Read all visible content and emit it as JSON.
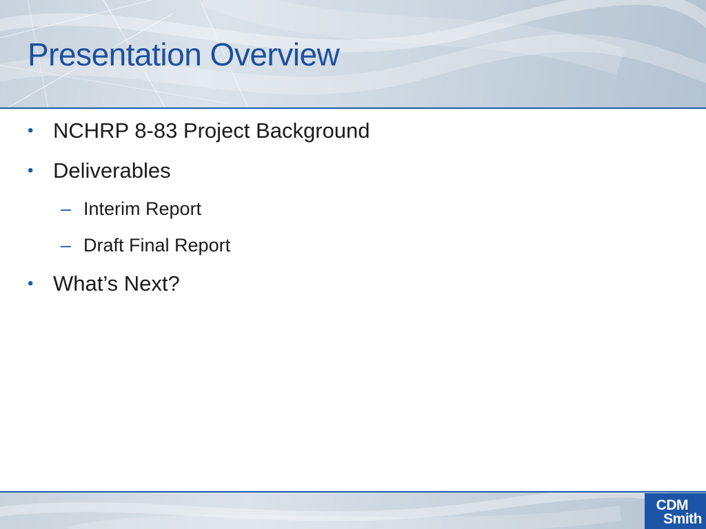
{
  "slide": {
    "title": "Presentation Overview",
    "bullets": [
      {
        "level": 1,
        "text": "NCHRP 8-83 Project Background"
      },
      {
        "level": 1,
        "text": "Deliverables"
      },
      {
        "level": 2,
        "text": "Interim Report"
      },
      {
        "level": 2,
        "text": "Draft Final Report"
      },
      {
        "level": 1,
        "text": "What’s Next?"
      }
    ],
    "markers": {
      "level1": "•",
      "level2": "–"
    }
  },
  "logo": {
    "line1": "CDM",
    "line2": "Smith"
  },
  "colors": {
    "title": "#1d4f9e",
    "accent": "#1f5aa8",
    "logo_bg": "#1c55a6",
    "header_band": "#cfd9e2"
  },
  "icons": {
    "bullet_level1": "bullet-dot-icon",
    "bullet_level2": "dash-icon",
    "logo": "cdm-smith-logo"
  }
}
